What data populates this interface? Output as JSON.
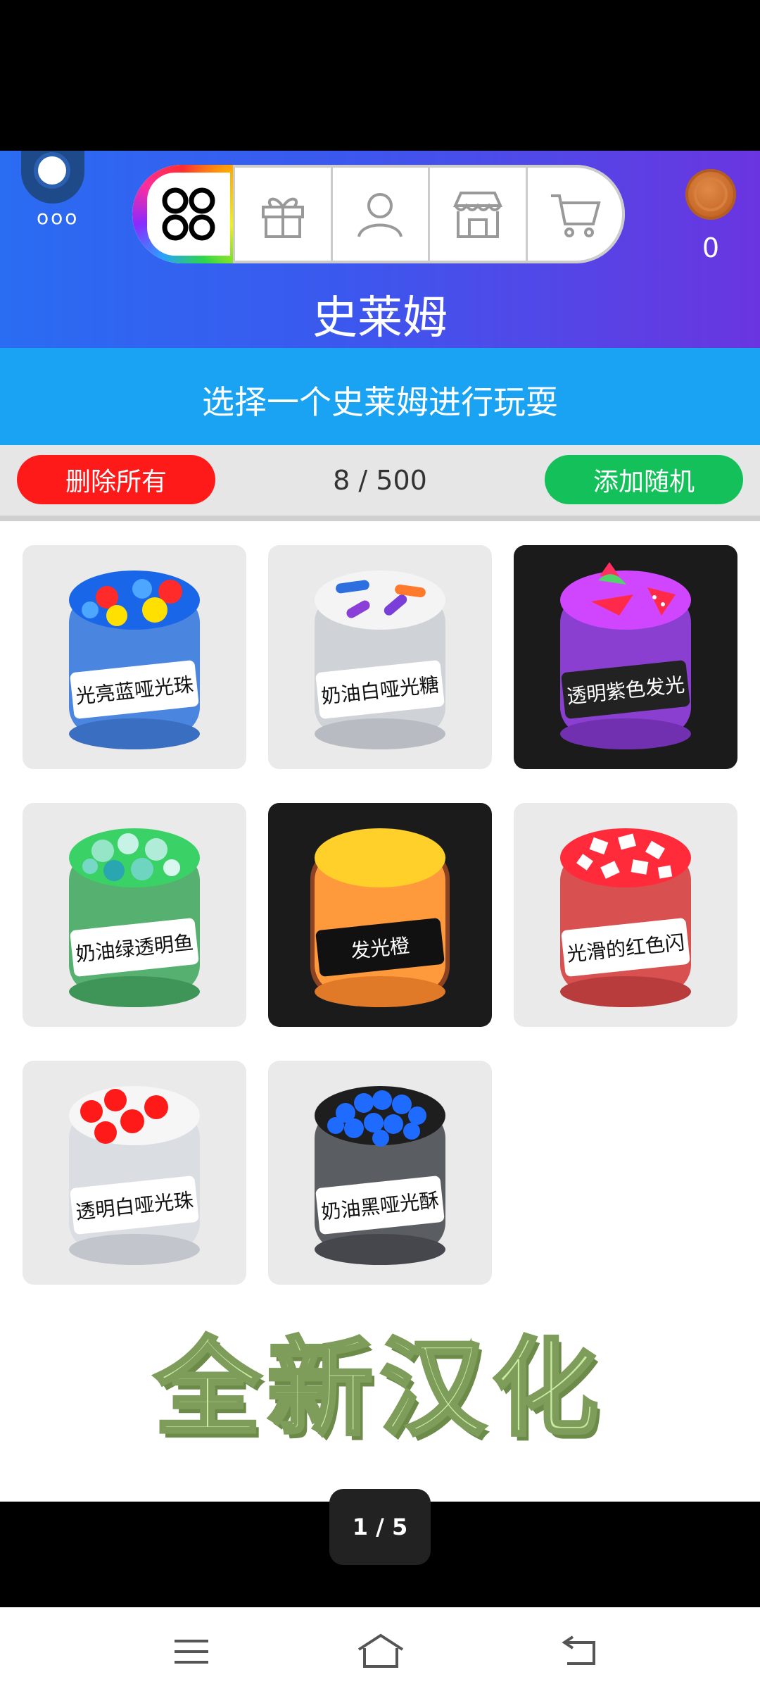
{
  "header": {
    "title": "史莱姆",
    "subtitle": "选择一个史莱姆进行玩耍",
    "coins": "0",
    "menu_dots": "ooo",
    "tabs": [
      {
        "name": "collection",
        "icon": "four-circles-icon",
        "active": true
      },
      {
        "name": "gift",
        "icon": "gift-icon"
      },
      {
        "name": "profile",
        "icon": "person-icon"
      },
      {
        "name": "shop",
        "icon": "store-icon"
      },
      {
        "name": "cart",
        "icon": "cart-icon"
      }
    ],
    "gradient": [
      "#2a6cf2",
      "#6a35e0"
    ],
    "subbar_color": "#19a3f2"
  },
  "actions": {
    "delete_all": "删除所有",
    "count": "8 / 500",
    "add_random": "添加随机",
    "delete_color": "#ff1a1a",
    "random_color": "#14c05a"
  },
  "slimes": [
    {
      "label": "光亮蓝哑光珠",
      "color": "#3a7ad8",
      "dark": false
    },
    {
      "label": "奶油白哑光糖",
      "color": "#e8e8e8",
      "dark": false
    },
    {
      "label": "透明紫色发光",
      "color": "#8a3fd0",
      "dark": true
    },
    {
      "label": "奶油绿透明鱼",
      "color": "#4cba6a",
      "dark": false
    },
    {
      "label": "发光橙",
      "color": "#ff9a3c",
      "dark": true
    },
    {
      "label": "光滑的红色闪",
      "color": "#e04848",
      "dark": false
    },
    {
      "label": "透明白哑光珠",
      "color": "#f0f0f0",
      "dark": false
    },
    {
      "label": "奶油黑哑光酥",
      "color": "#3b3b3b",
      "dark": false
    }
  ],
  "banner": "全新汉化",
  "pager": "1 / 5",
  "navbar": [
    "menu-icon",
    "home-icon",
    "back-icon"
  ]
}
